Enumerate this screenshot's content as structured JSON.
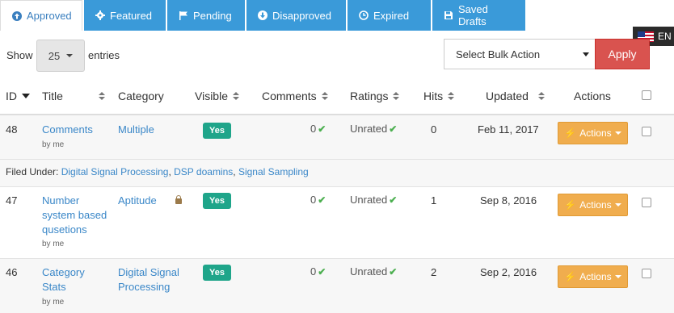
{
  "tabs": [
    {
      "label": "Approved",
      "icon": "arrow-up-circle-icon",
      "active": true
    },
    {
      "label": "Featured",
      "icon": "gear-icon",
      "active": false
    },
    {
      "label": "Pending",
      "icon": "flag-icon",
      "active": false
    },
    {
      "label": "Disapproved",
      "icon": "arrow-down-circle-icon",
      "active": false
    },
    {
      "label": "Expired",
      "icon": "clock-icon",
      "active": false
    },
    {
      "label": "Saved Drafts",
      "icon": "floppy-disk-icon",
      "active": false
    }
  ],
  "language": {
    "code": "EN",
    "flag": "us-flag-icon"
  },
  "controls": {
    "show_label": "Show",
    "entries_value": "25",
    "entries_label": "entries",
    "bulk_action_placeholder": "Select Bulk Action",
    "apply_label": "Apply"
  },
  "columns": {
    "id": "ID",
    "title": "Title",
    "category": "Category",
    "visible": "Visible",
    "comments": "Comments",
    "ratings": "Ratings",
    "hits": "Hits",
    "updated": "Updated",
    "actions": "Actions"
  },
  "filed_under": {
    "label": "Filed Under:",
    "tags": [
      "Digital Signal Processing",
      "DSP doamins",
      "Signal Sampling"
    ]
  },
  "rows": [
    {
      "id": "48",
      "title_lines": [
        "Comments"
      ],
      "author": "by me",
      "category_lines": [
        "Multiple"
      ],
      "locked": false,
      "visible": "Yes",
      "comments": "0",
      "ratings": "Unrated",
      "hits": "0",
      "updated": "Feb 11, 2017",
      "action_label": "Actions"
    },
    {
      "id": "47",
      "title_lines": [
        "Number",
        "system based",
        "qusetions"
      ],
      "author": "by me",
      "category_lines": [
        "Aptitude"
      ],
      "locked": true,
      "visible": "Yes",
      "comments": "0",
      "ratings": "Unrated",
      "hits": "1",
      "updated": "Sep 8, 2016",
      "action_label": "Actions"
    },
    {
      "id": "46",
      "title_lines": [
        "Category",
        "Stats"
      ],
      "author": "by me",
      "category_lines": [
        "Digital Signal",
        "Processing"
      ],
      "locked": false,
      "visible": "Yes",
      "comments": "0",
      "ratings": "Unrated",
      "hits": "2",
      "updated": "Sep 2, 2016",
      "action_label": "Actions"
    }
  ],
  "colors": {
    "tab_blue": "#3a9ad9",
    "apply_red": "#d9534f",
    "badge_green": "#1fa58a",
    "actions_orange": "#f0ad4e",
    "link_blue": "#3a87c8"
  }
}
